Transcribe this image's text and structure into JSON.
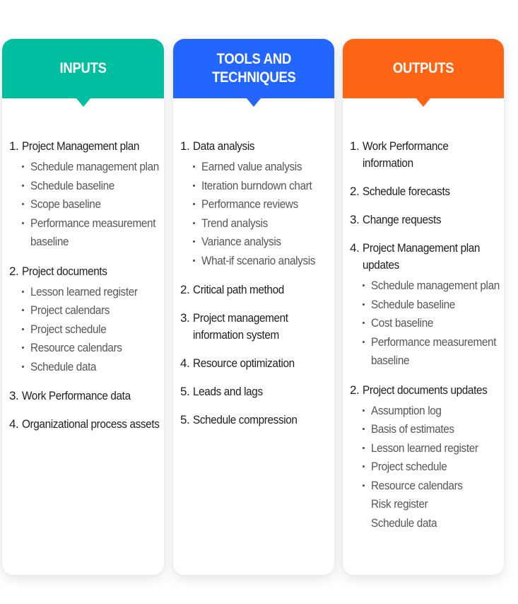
{
  "colors": {
    "inputs_header": "#00bfa0",
    "tools_header": "#2266ff",
    "outputs_header": "#ff6414",
    "main_text": "#1e1e1e",
    "sub_text": "#575757"
  },
  "columns": [
    {
      "title": "INPUTS",
      "items": [
        {
          "number": "1.",
          "label": "Project Management plan",
          "subitems": [
            {
              "label": "Schedule management plan",
              "bullet": true
            },
            {
              "label": "Schedule baseline",
              "bullet": true
            },
            {
              "label": "Scope baseline",
              "bullet": true
            },
            {
              "label": "Performance measurement baseline",
              "bullet": true
            }
          ]
        },
        {
          "number": "2.",
          "label": "Project documents",
          "subitems": [
            {
              "label": "Lesson learned register",
              "bullet": true
            },
            {
              "label": "Project calendars",
              "bullet": true
            },
            {
              "label": "Project schedule",
              "bullet": true
            },
            {
              "label": "Resource calendars",
              "bullet": true
            },
            {
              "label": "Schedule data",
              "bullet": true
            }
          ]
        },
        {
          "number": "3.",
          "label": "Work Performance data",
          "subitems": []
        },
        {
          "number": "4.",
          "label": "Organizational process assets",
          "subitems": []
        }
      ]
    },
    {
      "title": "TOOLS AND\nTECHNIQUES",
      "items": [
        {
          "number": "1.",
          "label": "Data analysis",
          "subitems": [
            {
              "label": "Earned value analysis",
              "bullet": true
            },
            {
              "label": "Iteration burndown chart",
              "bullet": true
            },
            {
              "label": "Performance reviews",
              "bullet": true
            },
            {
              "label": "Trend analysis",
              "bullet": true
            },
            {
              "label": "Variance analysis",
              "bullet": true
            },
            {
              "label": "What-if scenario analysis",
              "bullet": true
            }
          ]
        },
        {
          "number": "2.",
          "label": "Critical path method",
          "subitems": []
        },
        {
          "number": "3.",
          "label": "Project management information system",
          "subitems": []
        },
        {
          "number": "4.",
          "label": "Resource optimization",
          "subitems": []
        },
        {
          "number": "5.",
          "label": "Leads and lags",
          "subitems": []
        },
        {
          "number": "5.",
          "label": "Schedule compression",
          "subitems": []
        }
      ]
    },
    {
      "title": "OUTPUTS",
      "items": [
        {
          "number": "1.",
          "label": "Work Performance information",
          "subitems": []
        },
        {
          "number": "2.",
          "label": "Schedule forecasts",
          "subitems": []
        },
        {
          "number": "3.",
          "label": "Change requests",
          "subitems": []
        },
        {
          "number": "4.",
          "label": "Project Management plan updates",
          "subitems": [
            {
              "label": "Schedule management plan",
              "bullet": true
            },
            {
              "label": "Schedule baseline",
              "bullet": true
            },
            {
              "label": "Cost baseline",
              "bullet": true
            },
            {
              "label": "Performance measurement baseline",
              "bullet": true
            }
          ]
        },
        {
          "number": "2.",
          "label": "Project documents updates",
          "subitems": [
            {
              "label": "Assumption log",
              "bullet": true
            },
            {
              "label": "Basis of estimates",
              "bullet": true
            },
            {
              "label": "Lesson learned register",
              "bullet": true
            },
            {
              "label": "Project schedule",
              "bullet": true
            },
            {
              "label": "Resource calendars",
              "bullet": true
            },
            {
              "label": "Risk register",
              "bullet": false
            },
            {
              "label": "Schedule data",
              "bullet": false
            }
          ]
        }
      ]
    }
  ]
}
